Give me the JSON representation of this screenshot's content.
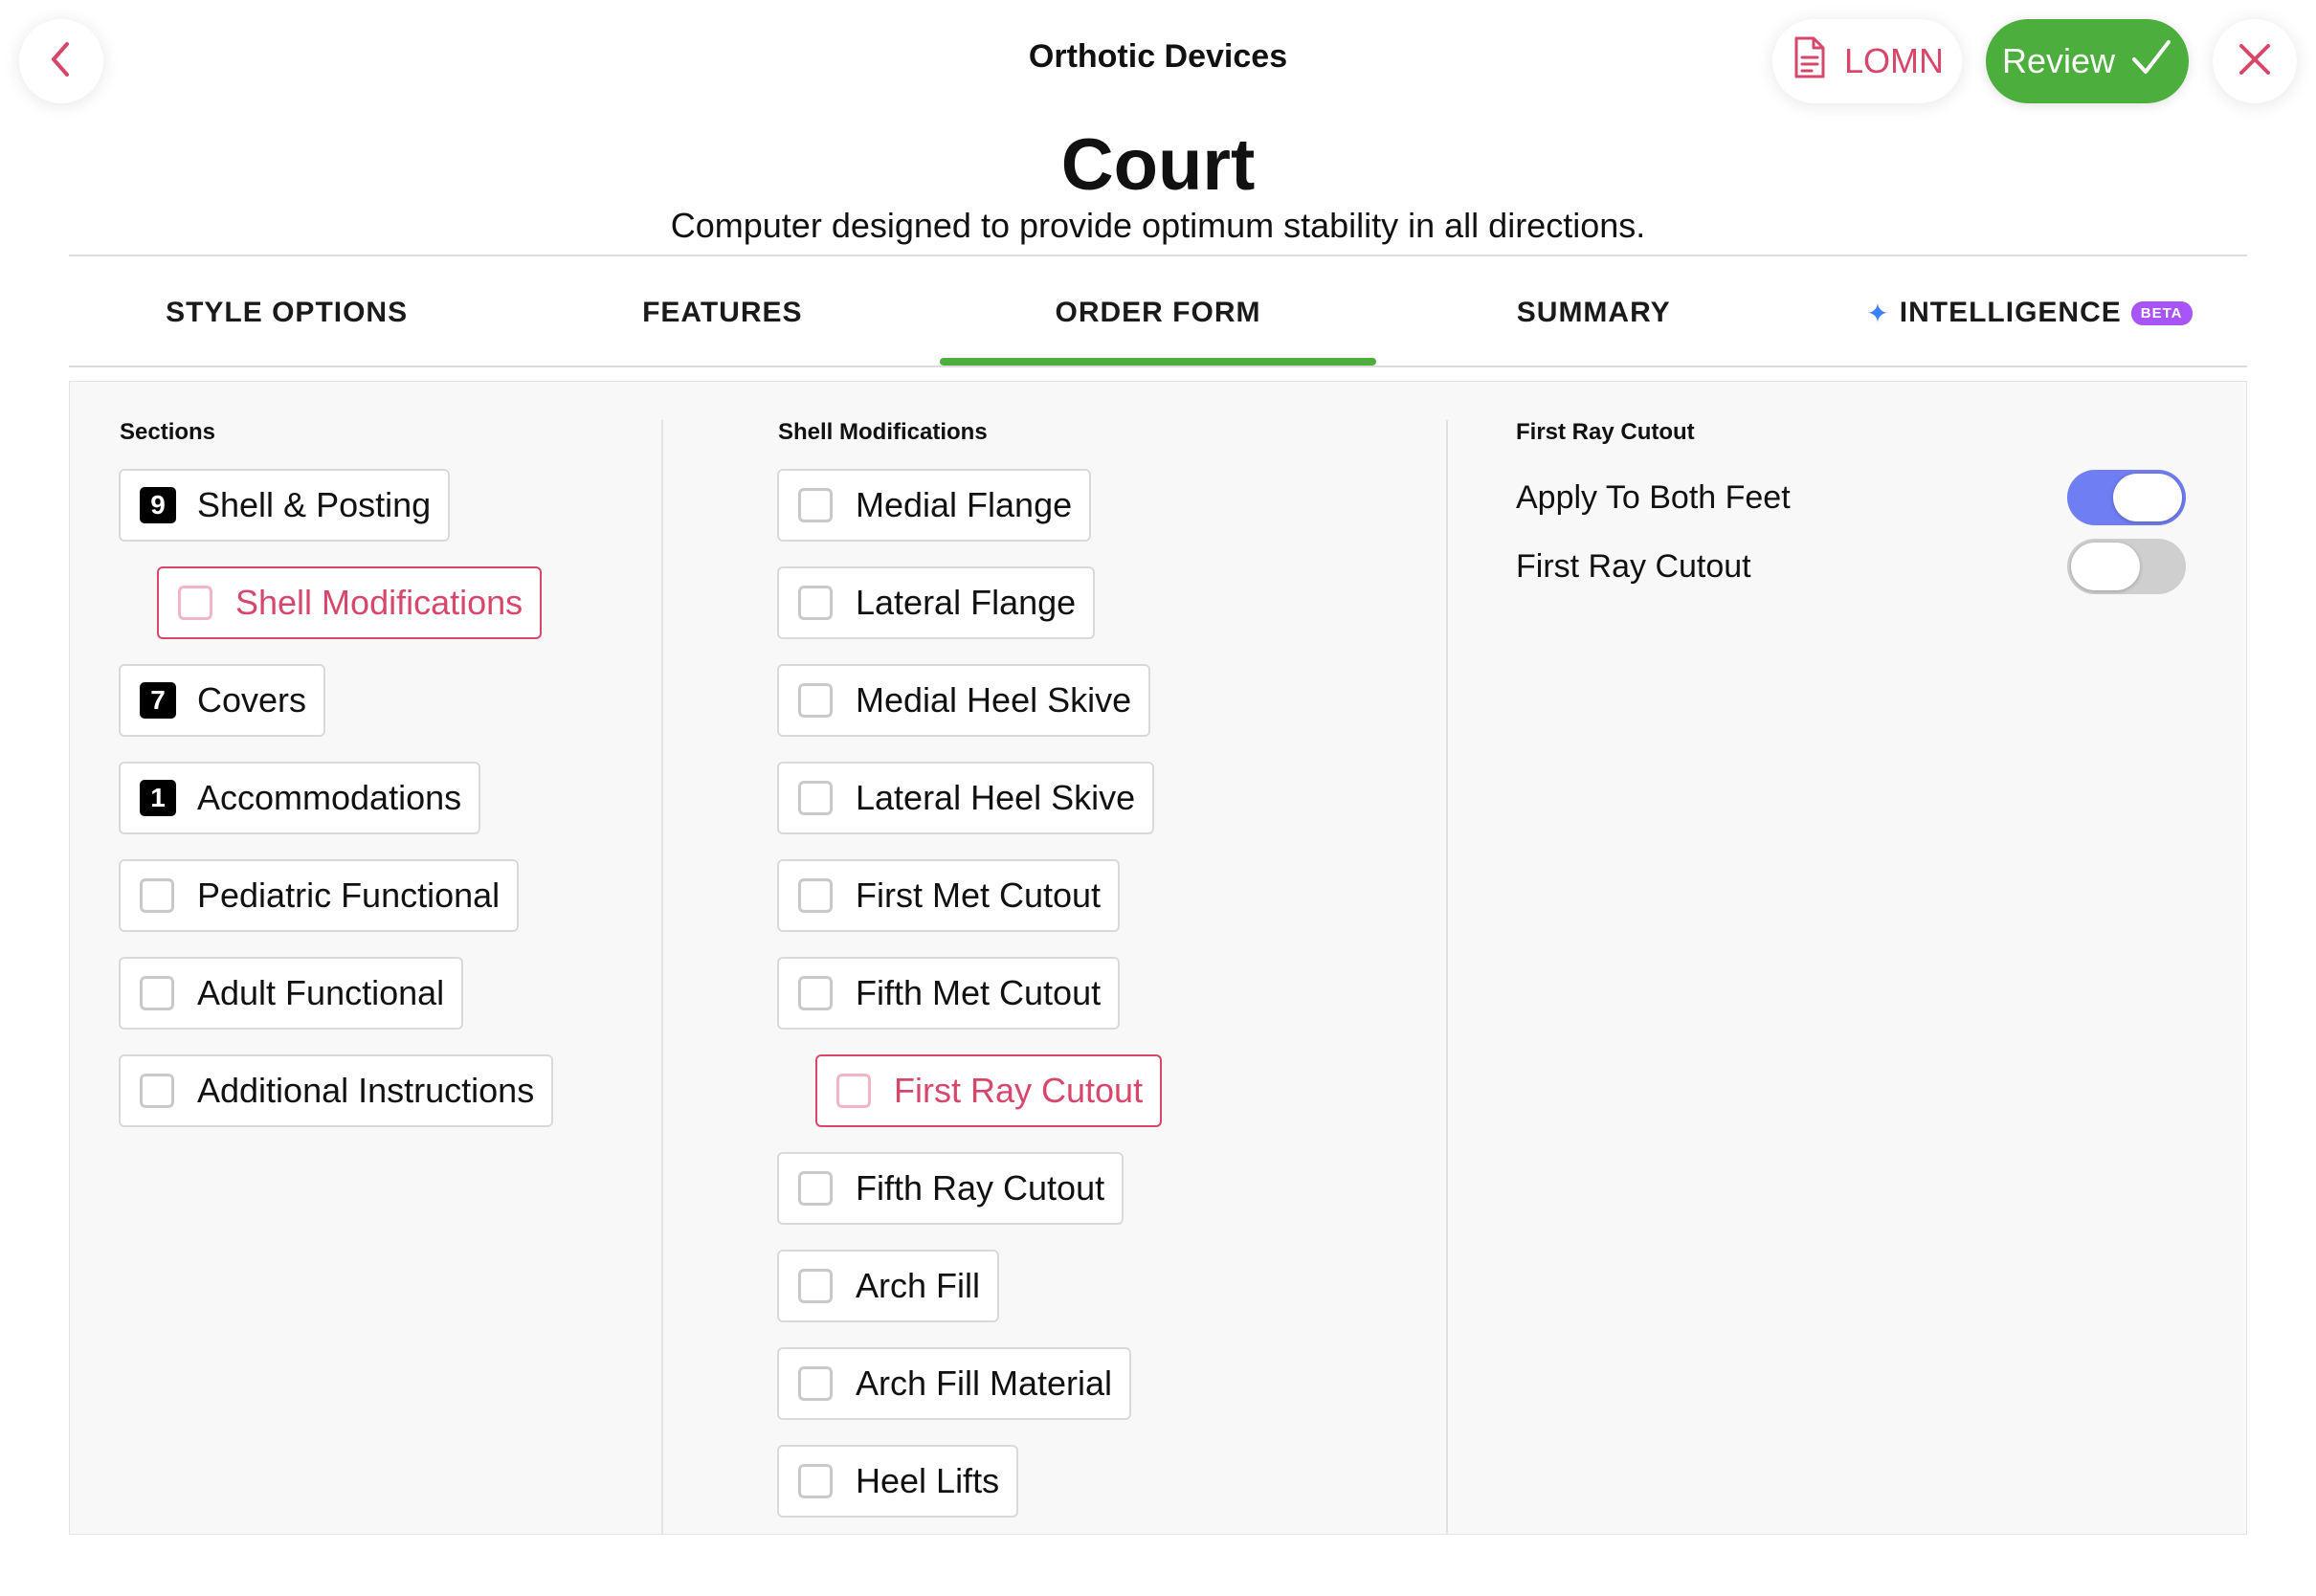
{
  "header": {
    "window_title": "Orthotic Devices",
    "lomn_label": "LOMN",
    "review_label": "Review",
    "title": "Court",
    "description": "Computer designed to provide optimum stability in all directions."
  },
  "tabs": [
    {
      "label": "STYLE OPTIONS",
      "active": false
    },
    {
      "label": "FEATURES",
      "active": false
    },
    {
      "label": "ORDER FORM",
      "active": true
    },
    {
      "label": "SUMMARY",
      "active": false
    },
    {
      "label": "INTELLIGENCE",
      "badge": "BETA",
      "active": false
    }
  ],
  "sections": {
    "label": "Sections",
    "items": [
      {
        "label": "Shell & Posting",
        "count": "9"
      },
      {
        "label": "Shell Modifications",
        "selected": true
      },
      {
        "label": "Covers",
        "count": "7"
      },
      {
        "label": "Accommodations",
        "count": "1"
      },
      {
        "label": "Pediatric Functional"
      },
      {
        "label": "Adult Functional"
      },
      {
        "label": "Additional Instructions"
      }
    ]
  },
  "shell_modifications": {
    "label": "Shell Modifications",
    "items": [
      {
        "label": "Medial Flange"
      },
      {
        "label": "Lateral Flange"
      },
      {
        "label": "Medial Heel Skive"
      },
      {
        "label": "Lateral Heel Skive"
      },
      {
        "label": "First Met Cutout"
      },
      {
        "label": "Fifth Met Cutout"
      },
      {
        "label": "First Ray Cutout",
        "selected": true
      },
      {
        "label": "Fifth Ray Cutout"
      },
      {
        "label": "Arch Fill"
      },
      {
        "label": "Arch Fill Material"
      },
      {
        "label": "Heel Lifts"
      }
    ]
  },
  "first_ray_cutout": {
    "label": "First Ray Cutout",
    "settings": [
      {
        "label": "Apply To Both Feet",
        "enabled": true
      },
      {
        "label": "First Ray Cutout",
        "enabled": false
      }
    ]
  },
  "colors": {
    "accent_pink": "#d6476b",
    "review_green": "#4cae3c",
    "toggle_on": "#6f7ef2",
    "toggle_off": "#cfcfcf",
    "beta_purple": "#a855f7"
  },
  "icons": {
    "back": "chevron-left-icon",
    "close": "close-icon",
    "lomn": "document-icon",
    "review": "checkmark-icon",
    "intelligence": "sparkle-icon"
  }
}
